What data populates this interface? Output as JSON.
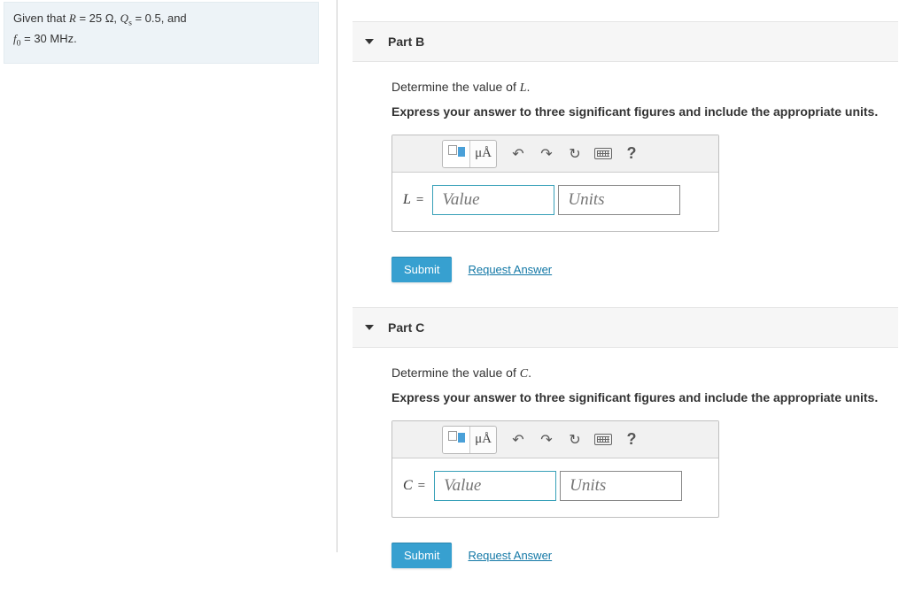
{
  "given": {
    "prefix": "Given that ",
    "R_var": "R",
    "R_eq": " = 25 Ω, ",
    "Qs_var": "Q",
    "Qs_sub": "s",
    "Qs_eq": " = 0.5, and",
    "f0_var": "f",
    "f0_sub": "0",
    "f0_eq": " = 30 MHz."
  },
  "parts": {
    "b": {
      "title": "Part B",
      "prompt_pre": "Determine the value of ",
      "prompt_var": "L",
      "prompt_post": ".",
      "instr": "Express your answer to three significant figures and include the appropriate units.",
      "var_label": "L",
      "value_ph": "Value",
      "units_ph": "Units",
      "submit": "Submit",
      "request": "Request Answer",
      "mu": "μÅ"
    },
    "c": {
      "title": "Part C",
      "prompt_pre": "Determine the value of ",
      "prompt_var": "C",
      "prompt_post": ".",
      "instr": "Express your answer to three significant figures and include the appropriate units.",
      "var_label": "C",
      "value_ph": "Value",
      "units_ph": "Units",
      "submit": "Submit",
      "request": "Request Answer",
      "mu": "μÅ"
    }
  }
}
